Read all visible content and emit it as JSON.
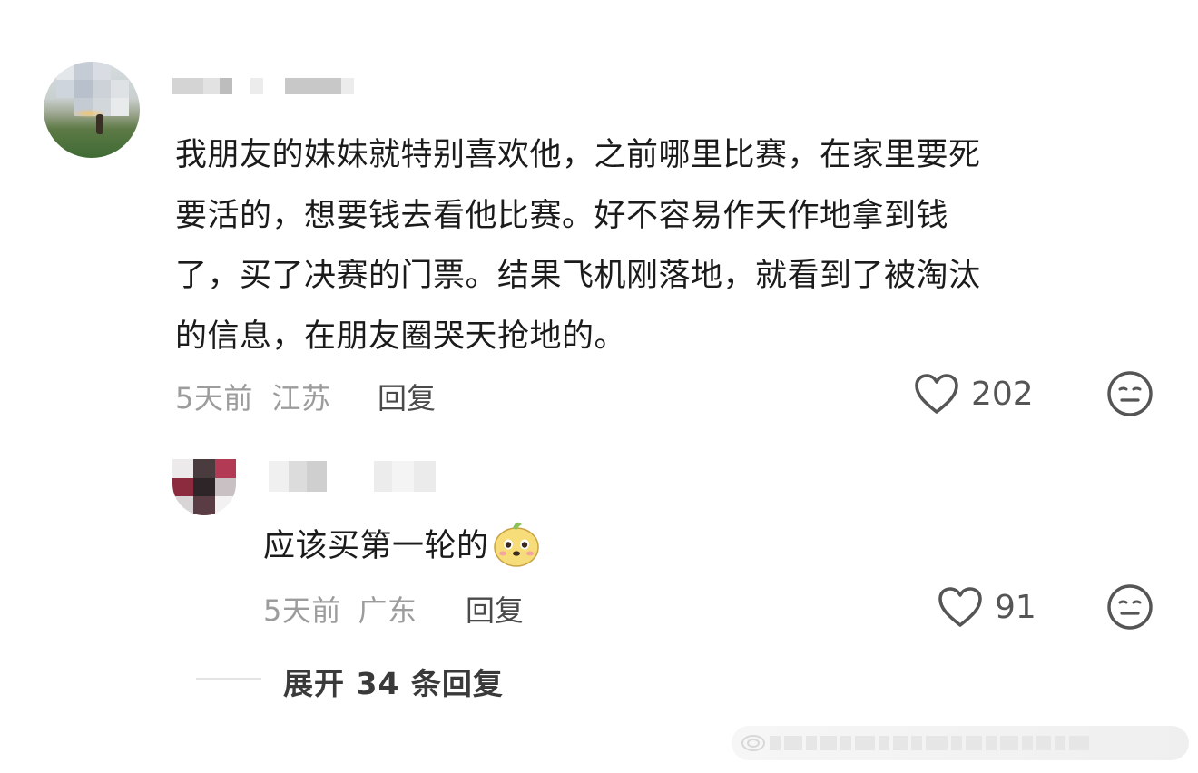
{
  "comment": {
    "text_lines": [
      "我朋友的妹妹就特别喜欢他，之前哪里比赛，在家里要死",
      "要活的，想要钱去看他比赛。好不容易作天作地拿到钱",
      "了，买了决赛的门票。结果飞机刚落地，就看到了被淘汰",
      "的信息，在朋友圈哭天抢地的。"
    ],
    "time": "5天前",
    "location": "江苏",
    "reply_label": "回复",
    "like_count": "202"
  },
  "reply": {
    "text": "应该买第一轮的",
    "time": "5天前",
    "location": "广东",
    "reply_label": "回复",
    "like_count": "91"
  },
  "expand_replies": "展开 34 条回复",
  "icons": {
    "like": "heart-outline-icon",
    "dislike": "neutral-face-icon",
    "emoji": "dog-face-emoji"
  },
  "colors": {
    "text": "#1b1b1b",
    "meta": "#9c9c9c",
    "icon": "#555555"
  }
}
